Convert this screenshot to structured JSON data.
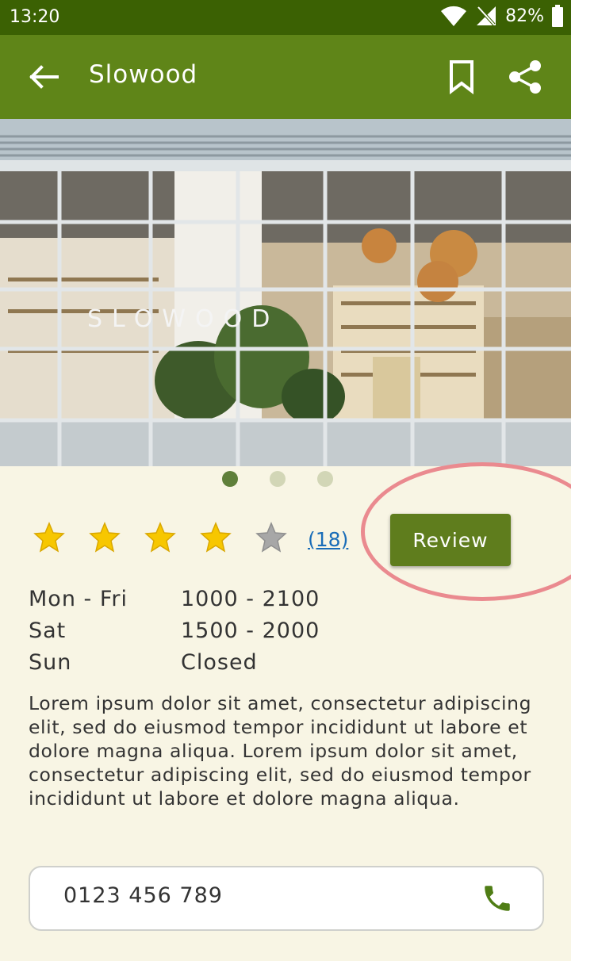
{
  "status_bar": {
    "time": "13:20",
    "battery": "82%"
  },
  "app_bar": {
    "title": "Slowood"
  },
  "hero": {
    "sign_text": "SLOWOOD",
    "carousel": {
      "pages": 3,
      "active": 1
    }
  },
  "rating": {
    "stars": 4,
    "max": 5,
    "count": "(18)",
    "star_color": "#f7c700",
    "empty_star_color": "#a7a7a7"
  },
  "review_button": {
    "label": "Review"
  },
  "hours": [
    {
      "day": "Mon - Fri",
      "time": "1000 - 2100"
    },
    {
      "day": "Sat",
      "time": "1500 - 2000"
    },
    {
      "day": "Sun",
      "time": "Closed"
    }
  ],
  "description": "Lorem ipsum dolor sit amet, consectetur adipiscing elit, sed do eiusmod tempor incididunt ut labore et dolore magna aliqua. Lorem ipsum dolor sit amet, consectetur adipiscing elit, sed do eiusmod tempor incididunt ut labore et dolore magna aliqua.",
  "phone": {
    "number": "0123 456 789",
    "icon": "phone-icon"
  },
  "colors": {
    "status_bar": "#3b6103",
    "app_bar": "#5f8518",
    "accent": "#5f7d1d",
    "background": "#f8f5e4",
    "highlight": "#ea8a8f"
  }
}
